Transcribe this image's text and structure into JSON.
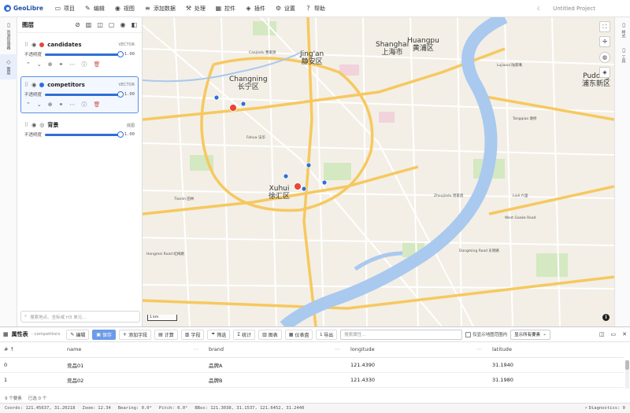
{
  "app": {
    "name": "GeoLibre",
    "project_title": "Untitled Project"
  },
  "menu": [
    {
      "label": "项目",
      "icon": "folder-icon"
    },
    {
      "label": "编辑",
      "icon": "pencil-icon"
    },
    {
      "label": "视图",
      "icon": "eye-icon"
    },
    {
      "label": "添加数据",
      "icon": "database-icon"
    },
    {
      "label": "处理",
      "icon": "wrench-icon"
    },
    {
      "label": "控件",
      "icon": "grid-icon"
    },
    {
      "label": "插件",
      "icon": "puzzle-icon"
    },
    {
      "label": "设置",
      "icon": "gear-icon"
    },
    {
      "label": "帮助",
      "icon": "help-icon"
    }
  ],
  "left_rail": [
    {
      "label": "资源管理器",
      "icon": "files-icon"
    },
    {
      "label": "图层",
      "icon": "layers-icon"
    }
  ],
  "right_rail": [
    {
      "label": "样式",
      "icon": "panel-icon"
    },
    {
      "label": "工具",
      "icon": "panel-icon"
    }
  ],
  "layer_panel": {
    "title": "图层",
    "opacity_label": "不透明度",
    "layers": [
      {
        "name": "candidates",
        "type": "VECTOR",
        "color": "#e8463a",
        "opacity": 1.0,
        "opacity_text": "1.00"
      },
      {
        "name": "competitors",
        "type": "VECTOR",
        "color": "#2f6fd6",
        "opacity": 1.0,
        "opacity_text": "1.00"
      },
      {
        "name": "背景",
        "type": "底图",
        "color": "#888888",
        "opacity": 1.0,
        "opacity_text": "1.00"
      }
    ],
    "search_placeholder": "搜索地点、坐标或 H3 单元..."
  },
  "map": {
    "scale_label": "1 km",
    "districts": [
      {
        "en": "Jing'an",
        "zh": "静安区"
      },
      {
        "en": "Shanghai",
        "zh": "上海市"
      },
      {
        "en": "Huangpu",
        "zh": "黄浦区"
      },
      {
        "en": "Changning",
        "zh": "长宁区"
      },
      {
        "en": "Xuhui",
        "zh": "徐汇区"
      },
      {
        "en": "Pudong",
        "zh": "浦东新区"
      }
    ],
    "minor_labels": [
      "Caojiadu 曹家渡",
      "Fahua 法华",
      "Tangqiao 塘桥",
      "Zhoujiadu 周家渡",
      "Liuli 六里",
      "Lujiazui 陆家嘴",
      "Dongming Road 东明路",
      "West Gaoke Road",
      "Hongmei Road 虹梅路",
      "Tianlin 田林"
    ]
  },
  "attribute_table": {
    "title": "属性表",
    "subtitle": "- competitors",
    "buttons": {
      "edit": "编辑",
      "save": "保存",
      "add_field": "添加字段",
      "calculate": "计算",
      "field": "字段",
      "filter": "筛选",
      "stats": "统计",
      "chart": "图表",
      "dashboard": "仪表盘",
      "export": "导出"
    },
    "search_placeholder": "搜索属性...",
    "only_visible_label": "仅显示地图范围内",
    "show_select": "显示所有要素",
    "columns": [
      "# ↑",
      "name",
      "brand",
      "longitude",
      "latitude"
    ],
    "rows": [
      [
        "0",
        "竞品01",
        "品牌A",
        "121.4390",
        "31.1940"
      ],
      [
        "1",
        "竞品02",
        "品牌B",
        "121.4330",
        "31.1980"
      ]
    ],
    "footer_count": "9 个要素",
    "footer_selected": "已选 0 个"
  },
  "status_bar": {
    "coords": "Coords: 121.45637, 31.20218",
    "zoom": "Zoom: 12.34",
    "bearing": "Bearing: 0.0°",
    "pitch": "Pitch: 0.0°",
    "bbox": "BBox: 121.3038, 31.1537, 121.6452, 31.2440",
    "diagnostics": "Diagnostics: 0"
  }
}
